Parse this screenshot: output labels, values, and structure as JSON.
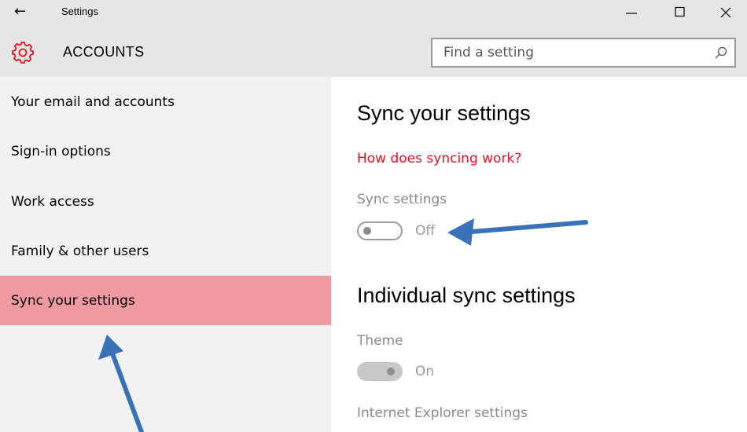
{
  "window": {
    "back_glyph": "←",
    "title": "Settings",
    "controls": [
      "minimize-icon",
      "maximize-icon",
      "close-icon"
    ]
  },
  "header": {
    "icon": "gear-icon",
    "title": "ACCOUNTS",
    "search_placeholder": "Find a setting",
    "search_icon": "search-icon"
  },
  "sidebar": {
    "items": [
      {
        "label": "Your email and accounts",
        "selected": false
      },
      {
        "label": "Sign-in options",
        "selected": false
      },
      {
        "label": "Work access",
        "selected": false
      },
      {
        "label": "Family & other users",
        "selected": false
      },
      {
        "label": "Sync your settings",
        "selected": true
      }
    ]
  },
  "main": {
    "heading": "Sync your settings",
    "help_link": "How does syncing work?",
    "sync_settings": {
      "label": "Sync settings",
      "state": "Off"
    },
    "individual_heading": "Individual sync settings",
    "theme": {
      "label": "Theme",
      "state": "On"
    },
    "ie_settings": {
      "label": "Internet Explorer settings"
    }
  },
  "colors": {
    "accent": "#e81123",
    "selected_bg": "#ee9aa0",
    "annotation_arrow": "#3a72b8",
    "titlebar_bg": "#e6e6e6",
    "sidebar_bg": "#f2f2f2"
  }
}
